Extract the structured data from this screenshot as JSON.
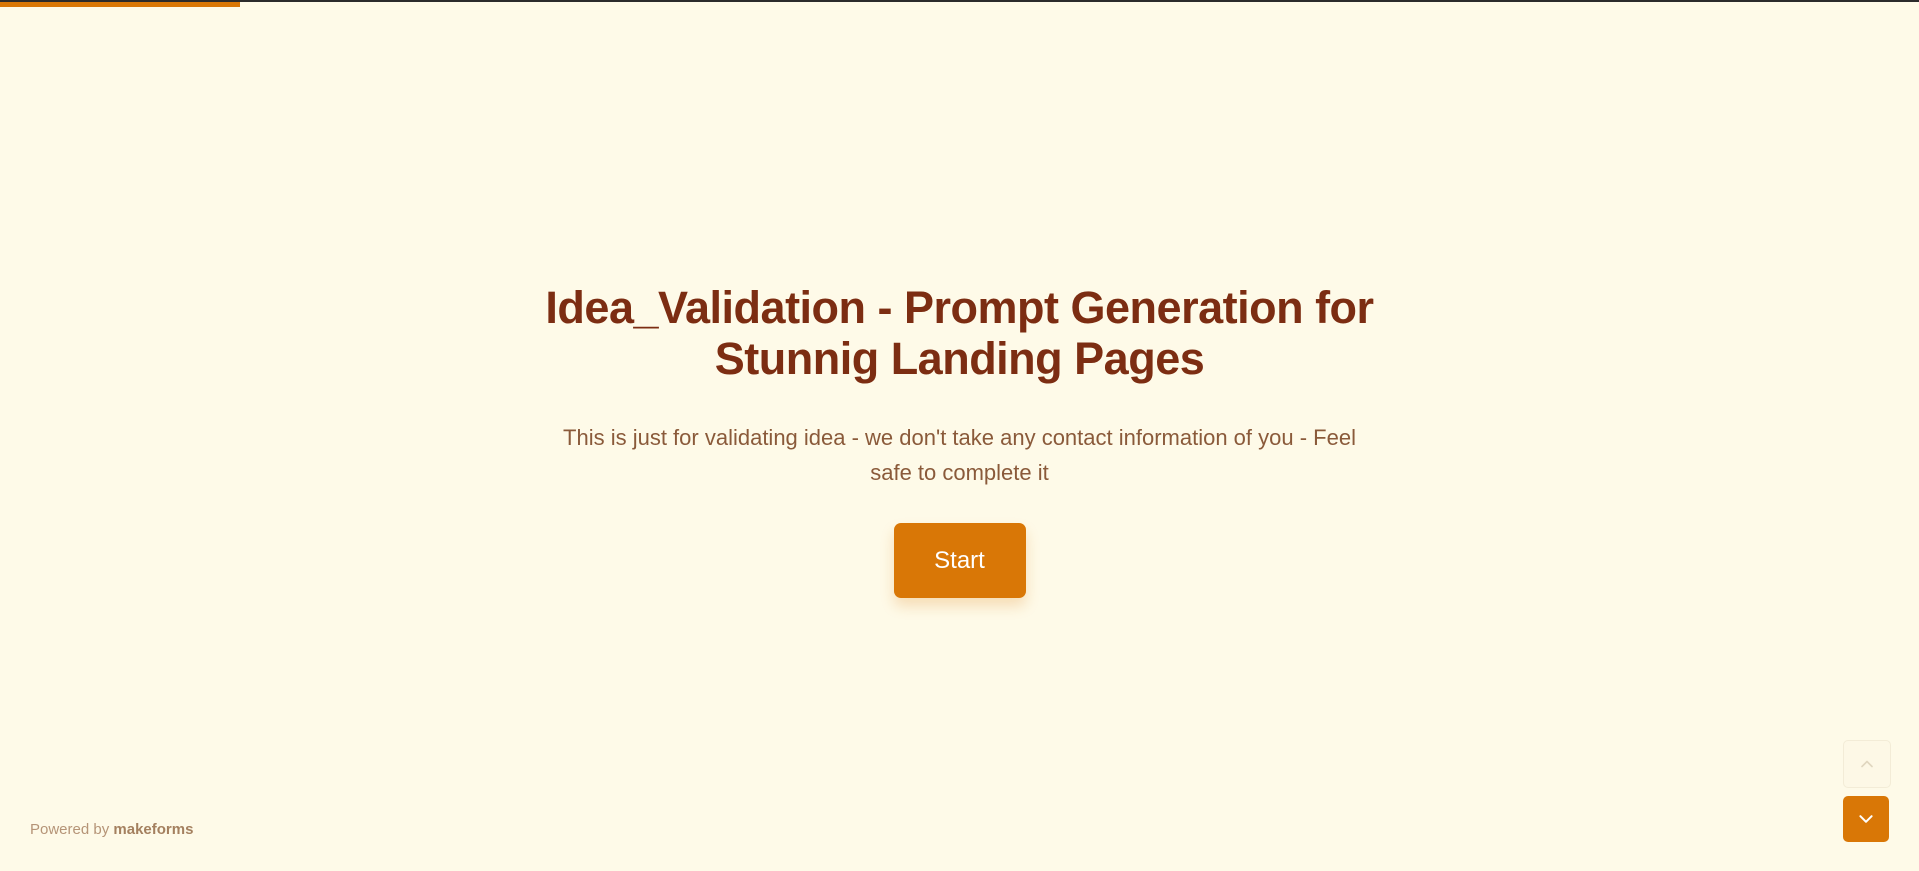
{
  "form": {
    "title": "Idea_Validation - Prompt Generation for Stunnig Landing Pages",
    "description": "This is just for validating idea - we don't take any contact information of you - Feel safe to complete it",
    "start_label": "Start",
    "progress_fraction": 0.125
  },
  "footer": {
    "powered_prefix": "Powered by",
    "brand": "makeforms"
  },
  "nav": {
    "up_icon": "chevron-up-icon",
    "down_icon": "chevron-down-icon"
  },
  "colors": {
    "background": "#fefae8",
    "accent": "#d97706",
    "title": "#7c2d12",
    "text": "#8a5a3a"
  }
}
